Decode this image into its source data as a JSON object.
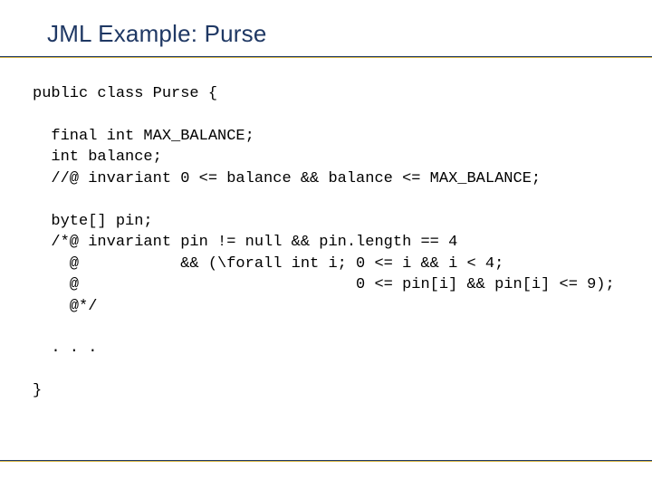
{
  "title": "JML Example: Purse",
  "code": {
    "l01": "public class Purse {",
    "l02": "",
    "l03": "  final int MAX_BALANCE;",
    "l04": "  int balance;",
    "l05": "  //@ invariant 0 <= balance && balance <= MAX_BALANCE;",
    "l06": "",
    "l07": "  byte[] pin;",
    "l08": "  /*@ invariant pin != null && pin.length == 4",
    "l09": "    @           && (\\forall int i; 0 <= i && i < 4;",
    "l10": "    @                              0 <= pin[i] && pin[i] <= 9);",
    "l11": "    @*/",
    "l12": "",
    "l13": "  . . .",
    "l14": "",
    "l15": "}"
  }
}
